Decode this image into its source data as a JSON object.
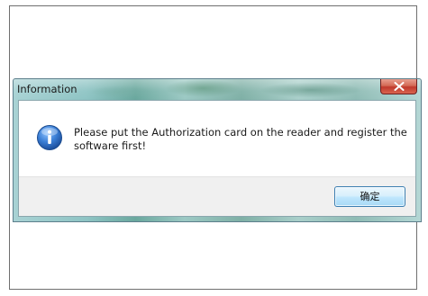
{
  "dialog": {
    "title": "Information",
    "message": "Please put the Authorization card on the reader and register the software first!",
    "icon": "information-icon",
    "ok_label": "确定",
    "close_icon": "close-icon"
  },
  "colors": {
    "close_button": "#c0392b",
    "info_icon": "#2a63b8",
    "ok_button_border": "#3c7fb1"
  }
}
